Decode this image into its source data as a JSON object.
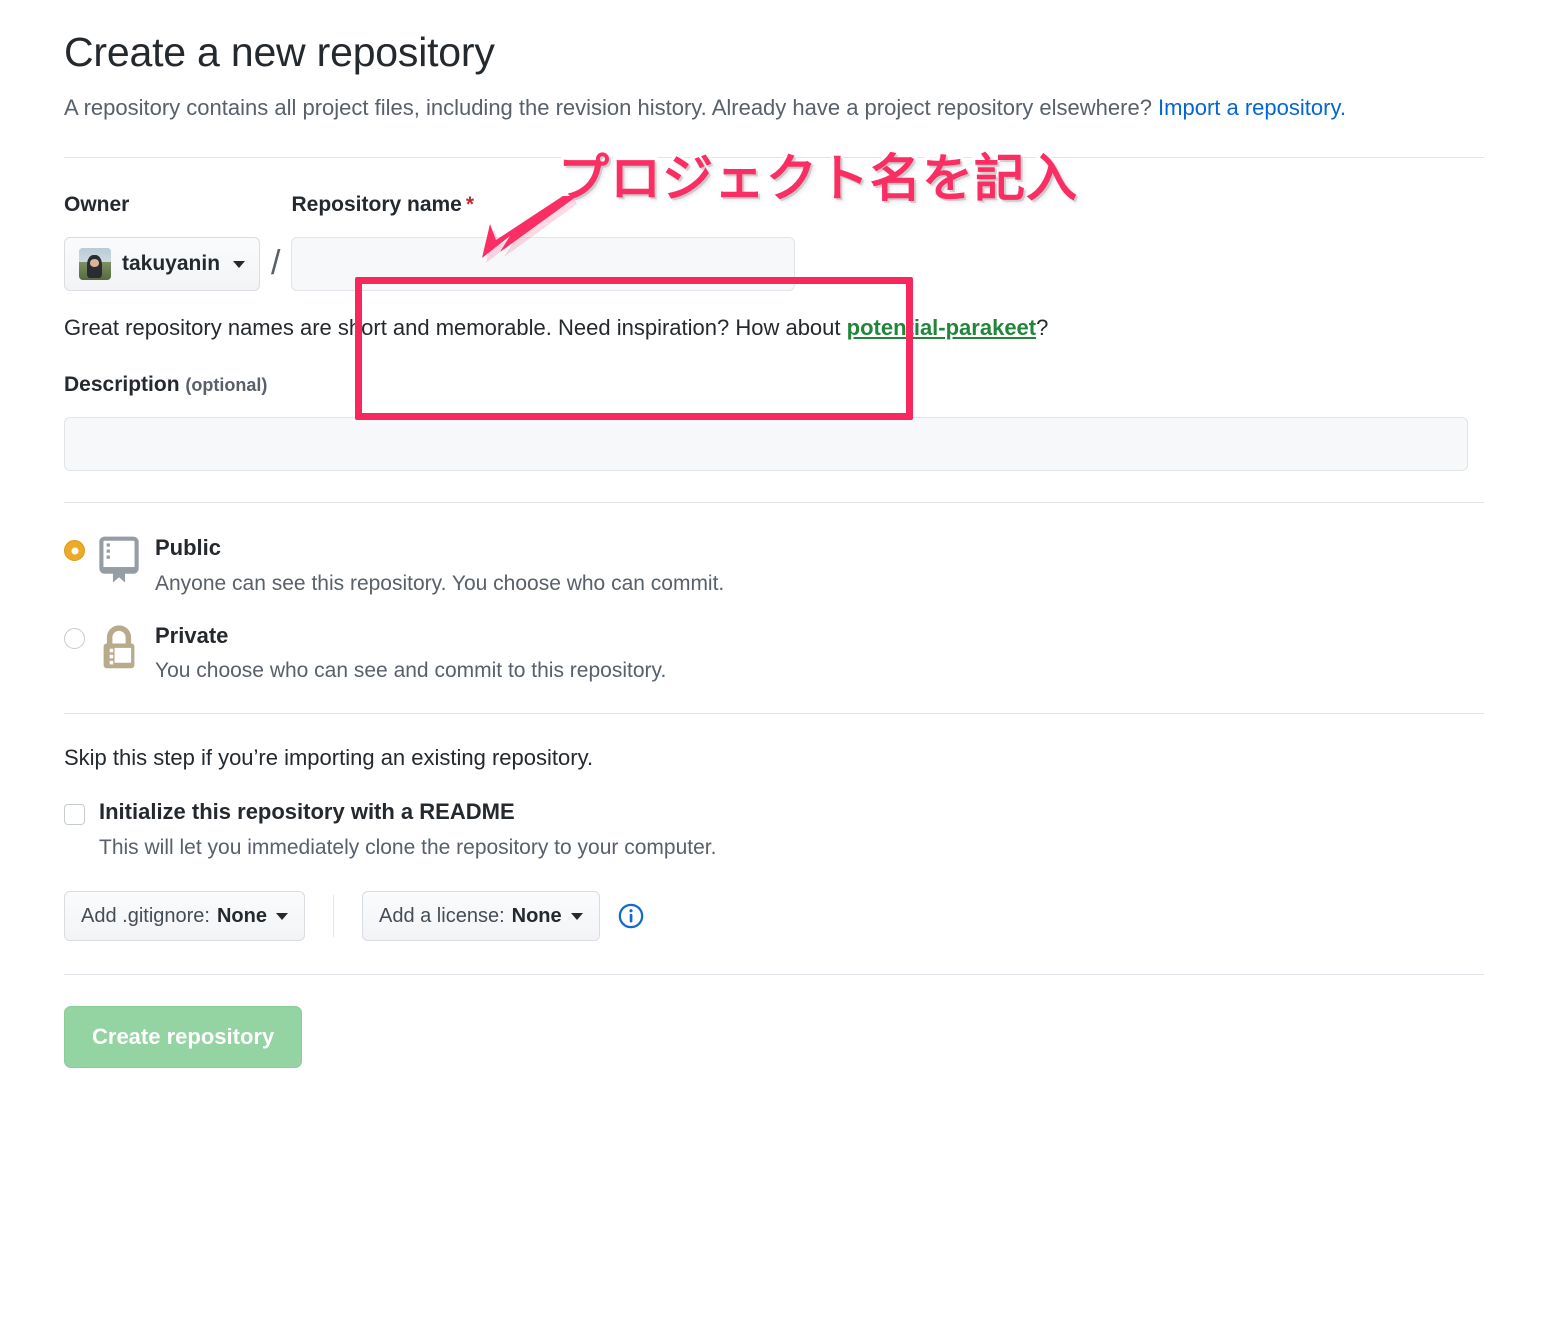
{
  "header": {
    "title": "Create a new repository",
    "subtitle_part1": "A repository contains all project files, including the revision history. Already have a project repository elsewhere? ",
    "import_link": "Import a repository."
  },
  "owner": {
    "label": "Owner",
    "username": "takuyanin",
    "separator": "/"
  },
  "repo_name": {
    "label": "Repository name",
    "required_mark": "*",
    "value": "",
    "placeholder": ""
  },
  "hint": {
    "prefix": "Great repository names are short and memorable. Need inspiration? How about ",
    "suggestion": "potential-parakeet",
    "suffix": "?"
  },
  "description": {
    "label": "Description",
    "optional": "(optional)",
    "value": "",
    "placeholder": ""
  },
  "visibility": {
    "options": [
      {
        "id": "public",
        "title": "Public",
        "desc": "Anyone can see this repository. You choose who can commit.",
        "icon": "repo-book-icon",
        "selected": true
      },
      {
        "id": "private",
        "title": "Private",
        "desc": "You choose who can see and commit to this repository.",
        "icon": "lock-icon",
        "selected": false
      }
    ]
  },
  "initialize": {
    "skip_text": "Skip this step if you’re importing an existing repository.",
    "readme_label": "Initialize this repository with a README",
    "readme_desc": "This will let you immediately clone the repository to your computer.",
    "readme_checked": false,
    "gitignore_label": "Add .gitignore: ",
    "gitignore_value": "None",
    "license_label": "Add a license: ",
    "license_value": "None"
  },
  "submit": {
    "label": "Create repository"
  },
  "annotation": {
    "text": "プロジェクト名を記入",
    "color": "#fb2e63"
  },
  "colors": {
    "accent_link": "#0366d6",
    "suggestion_green": "#22863a",
    "required_red": "#cb2431",
    "radio_orange": "#ebab27",
    "public_icon_gray": "#959da5",
    "private_icon_tan": "#b7ab8b",
    "submit_green": "#94d3a2",
    "annotation_pink": "#fb2e63",
    "divider": "#e1e4e8"
  }
}
